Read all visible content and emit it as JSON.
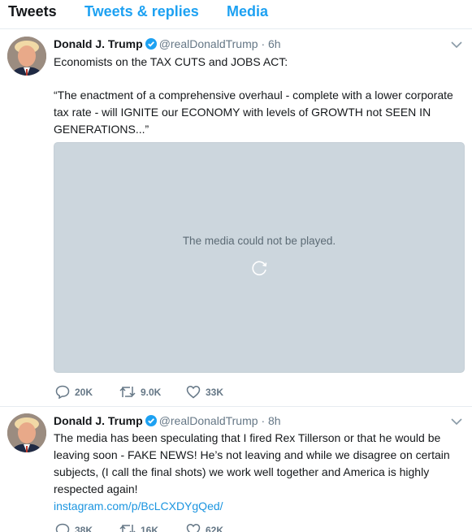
{
  "tabs": [
    {
      "label": "Tweets",
      "active": true
    },
    {
      "label": "Tweets & replies",
      "active": false
    },
    {
      "label": "Media",
      "active": false
    }
  ],
  "colors": {
    "accent": "#1da1f2",
    "text": "#14171a",
    "muted": "#657786",
    "link": "#1b95e0",
    "media_bg": "#ccd6dd"
  },
  "tweets": [
    {
      "name": "Donald J. Trump",
      "handle": "@realDonaldTrump",
      "separator": "·",
      "time": "6h",
      "text_line1": "Economists on the TAX CUTS and JOBS ACT:",
      "text_quote": "“The enactment of a comprehensive overhaul - complete with a lower corporate tax rate - will IGNITE our ECONOMY with levels of GROWTH not SEEN IN GENERATIONS...”",
      "media_message": "The media could not be played.",
      "replies": "20K",
      "retweets": "9.0K",
      "likes": "33K",
      "icons": [
        "verified-badge-icon",
        "chevron-down-icon",
        "reload-icon",
        "reply-icon",
        "retweet-icon",
        "heart-icon"
      ]
    },
    {
      "name": "Donald J. Trump",
      "handle": "@realDonaldTrump",
      "separator": "·",
      "time": "8h",
      "text": "The media has been speculating that I fired Rex Tillerson or that he would be leaving soon - FAKE NEWS! He’s not leaving and while we disagree on certain subjects, (I call the final shots) we work well together and America is highly respected again!",
      "link": "instagram.com/p/BcLCXDYgQed/",
      "replies": "38K",
      "retweets": "16K",
      "likes": "62K",
      "icons": [
        "verified-badge-icon",
        "chevron-down-icon",
        "reply-icon",
        "retweet-icon",
        "heart-icon"
      ]
    }
  ]
}
